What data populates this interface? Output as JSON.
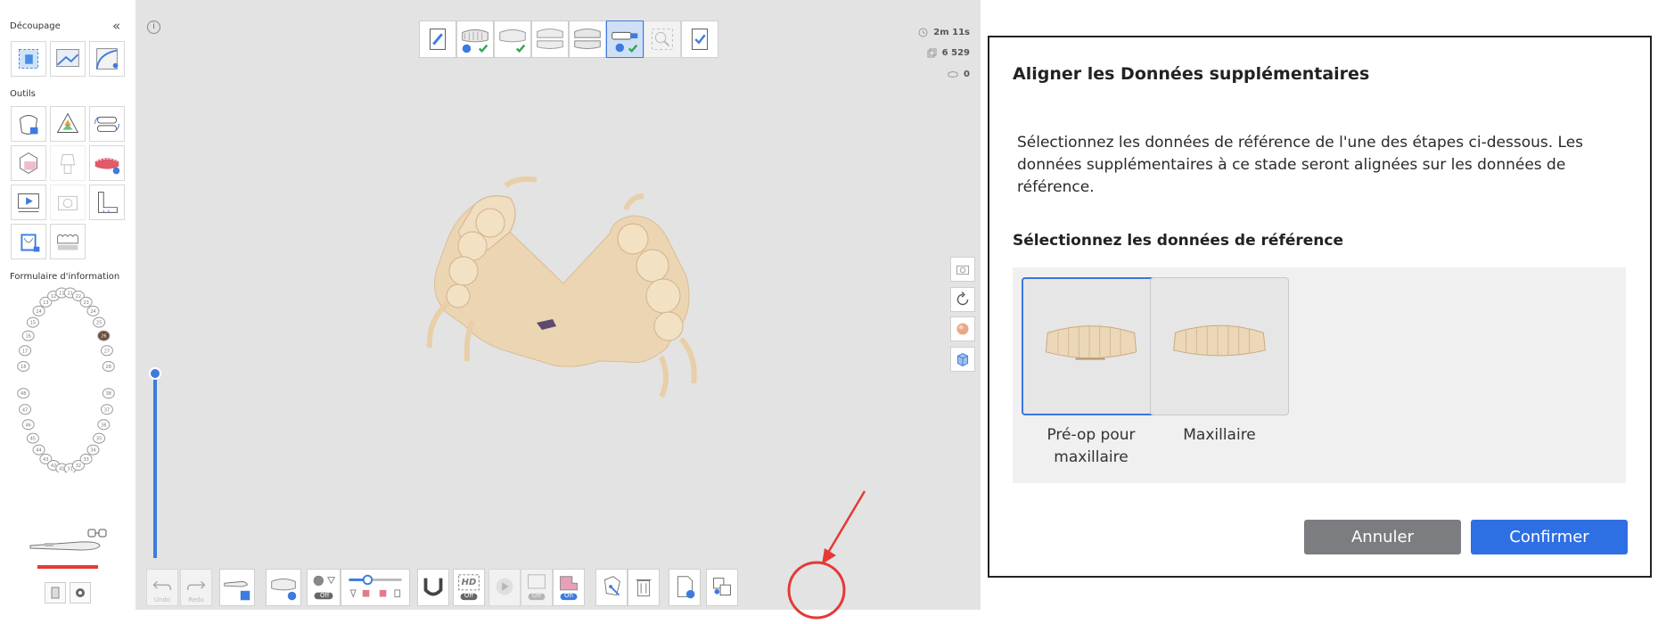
{
  "left_panel": {
    "sections": {
      "decoupage": "Découpage",
      "outils": "Outils",
      "formulaire": "Formulaire d'information"
    },
    "collapse_glyph": "«",
    "decoupage_tools": [
      "crop-select-icon",
      "crop-image-icon",
      "crop-curve-icon"
    ],
    "outils_tools": [
      {
        "icon": "lock-tooth-icon",
        "enabled": true
      },
      {
        "icon": "color-map-icon",
        "enabled": true
      },
      {
        "icon": "arch-sync-icon",
        "enabled": true
      },
      {
        "icon": "overlay-compare-icon",
        "enabled": true
      },
      {
        "icon": "abutment-icon",
        "enabled": false
      },
      {
        "icon": "jaw-add-icon",
        "enabled": true
      },
      {
        "icon": "play-video-icon",
        "enabled": true
      },
      {
        "icon": "camera-capture-icon",
        "enabled": false
      },
      {
        "icon": "measure-ruler-icon",
        "enabled": true
      },
      {
        "icon": "section-view-icon",
        "enabled": true
      },
      {
        "icon": "teeth-row-icon",
        "enabled": true
      }
    ],
    "upper_teeth": [
      "18",
      "17",
      "16",
      "15",
      "14",
      "13",
      "12",
      "11",
      "21",
      "22",
      "23",
      "24",
      "25",
      "26",
      "27",
      "28"
    ],
    "lower_teeth": [
      "48",
      "47",
      "46",
      "45",
      "44",
      "43",
      "42",
      "41",
      "31",
      "32",
      "33",
      "34",
      "35",
      "36",
      "37",
      "38"
    ],
    "scanner_icon": "scanner-handpiece-icon",
    "status_color": "#e53935"
  },
  "viewport": {
    "info_icon": "info-icon",
    "stages": [
      {
        "icon": "edit-notes-icon",
        "active": false
      },
      {
        "icon": "maxilla-stage-icon",
        "active": false
      },
      {
        "icon": "mandible-stage-icon",
        "active": false
      },
      {
        "icon": "occlusion-stage-icon",
        "active": false
      },
      {
        "icon": "occlusion-stage-icon",
        "active": false
      },
      {
        "icon": "additional-data-icon",
        "active": true
      },
      {
        "icon": "search-scan-icon",
        "active": false
      },
      {
        "icon": "checklist-icon",
        "active": false
      }
    ],
    "stats": [
      {
        "icon": "clock-icon",
        "value": "2m 11s"
      },
      {
        "icon": "copy-stack-icon",
        "value": "6 529"
      },
      {
        "icon": "jaw-count-icon",
        "value": "0"
      }
    ],
    "side_controls": [
      "camera-view-icon",
      "rotate-icon",
      "texture-ball-icon",
      "cube-view-icon"
    ],
    "slider_level": 0.04,
    "bottom_tools": {
      "undo": "Undo",
      "redo": "Redo",
      "off": "Off",
      "on": "On",
      "hd": "HD"
    },
    "colors": {
      "accent": "#3d7be0",
      "model": "#ecd5b3",
      "annotation": "#e53935"
    }
  },
  "dialog": {
    "title": "Aligner les Données supplémentaires",
    "description": "Sélectionnez les données de référence de l'une des étapes ci-dessous. Les données supplémentaires à ce stade seront alignées sur les données de référence.",
    "subtitle": "Sélectionnez les données de référence",
    "options": [
      {
        "label": "Pré-op pour maxillaire",
        "selected": true
      },
      {
        "label": "Maxillaire",
        "selected": false
      }
    ],
    "cancel": "Annuler",
    "confirm": "Confirmer",
    "colors": {
      "cancel": "#7b7d80",
      "confirm": "#2f6fe4"
    }
  }
}
